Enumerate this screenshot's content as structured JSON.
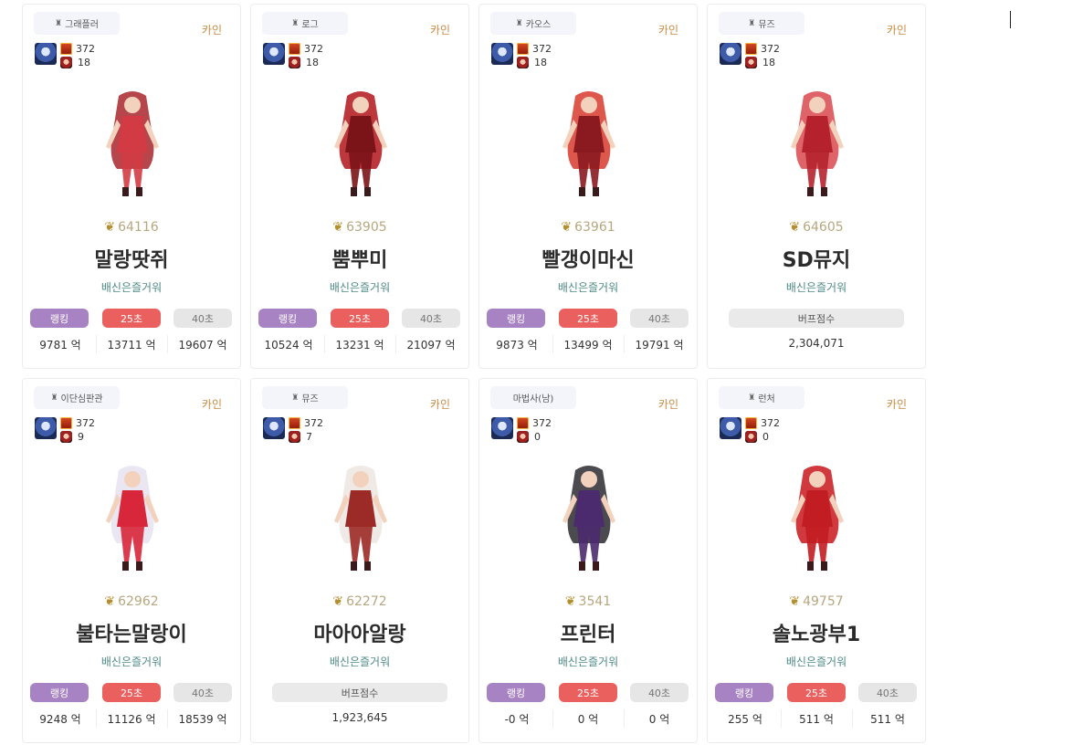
{
  "common": {
    "level": "372",
    "guild": "배신은즐거워",
    "server": "카인",
    "rank_label": "랭킹",
    "sec25_label": "25초",
    "sec40_label": "40초",
    "buff_label": "버프점수"
  },
  "cards": [
    {
      "job": "그래플러",
      "count": "18",
      "fame": "64116",
      "name": "말랑땃쥐",
      "type": "dps",
      "v1": "9781 억",
      "v2": "13711 억",
      "v3": "19607 억",
      "body_color": "#d23b44",
      "hair_color": "#a8262b"
    },
    {
      "job": "로그",
      "count": "18",
      "fame": "63905",
      "name": "뿜뿌미",
      "type": "dps",
      "v1": "10524 억",
      "v2": "13231 억",
      "v3": "21097 억",
      "body_color": "#7a1418",
      "hair_color": "#b0151a"
    },
    {
      "job": "카오스",
      "count": "18",
      "fame": "63961",
      "name": "빨갱이마신",
      "type": "dps",
      "v1": "9873 억",
      "v2": "13499 억",
      "v3": "19791 억",
      "body_color": "#8a1a20",
      "hair_color": "#d73a2e"
    },
    {
      "job": "뮤즈",
      "count": "18",
      "fame": "64605",
      "name": "SD뮤지",
      "type": "buff",
      "buff": "2,304,071",
      "body_color": "#b5222e",
      "hair_color": "#d9494f"
    },
    {
      "job": "이단심판관",
      "count": "9",
      "fame": "62962",
      "name": "불타는말랑이",
      "type": "dps",
      "v1": "9248 억",
      "v2": "11126 억",
      "v3": "18539 억",
      "body_color": "#d8263a",
      "hair_color": "#e8e3f0"
    },
    {
      "job": "뮤즈",
      "count": "7",
      "fame": "62272",
      "name": "마아아알랑",
      "type": "buff",
      "buff": "1,923,645",
      "body_color": "#9c2a26",
      "hair_color": "#ece6e0"
    },
    {
      "job": "마법사(남)",
      "count": "0",
      "fame": "3541",
      "name": "프린터",
      "type": "dps",
      "v1": "-0 억",
      "v2": "0 억",
      "v3": "0 억",
      "body_color": "#4b2a6e",
      "hair_color": "#2a2a30"
    },
    {
      "job": "런처",
      "count": "0",
      "fame": "49757",
      "name": "솔노광부1",
      "type": "dps",
      "v1": "255 억",
      "v2": "511 억",
      "v3": "511 억",
      "body_color": "#c21d22",
      "hair_color": "#c8161b"
    }
  ]
}
